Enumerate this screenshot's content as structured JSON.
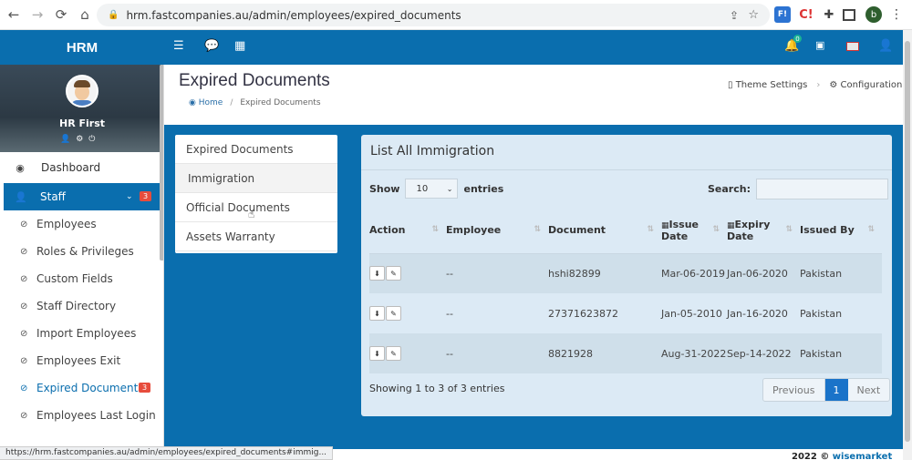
{
  "browser": {
    "url": "hrm.fastcompanies.au/admin/employees/expired_documents",
    "status_url": "https://hrm.fastcompanies.au/admin/employees/expired_documents#immig...",
    "profile_initial": "b",
    "ext_fl": "F!",
    "ext_c": "C!"
  },
  "topbar": {
    "brand": "HRM",
    "bell_count": "0"
  },
  "sidebar": {
    "user_name": "HR First",
    "dashboard_label": "Dashboard",
    "staff_label": "Staff",
    "staff_badge": "3",
    "items": [
      {
        "label": "Employees"
      },
      {
        "label": "Roles & Privileges"
      },
      {
        "label": "Custom Fields"
      },
      {
        "label": "Staff Directory"
      },
      {
        "label": "Import Employees"
      },
      {
        "label": "Employees Exit"
      },
      {
        "label": "Expired Documents",
        "badge": "3",
        "active": true
      },
      {
        "label": "Employees Last Login"
      }
    ]
  },
  "header": {
    "title": "Expired Documents",
    "breadcrumb_home": "Home",
    "breadcrumb_current": "Expired Documents",
    "theme_settings": "Theme Settings",
    "configuration": "Configuration"
  },
  "doc_tabs": [
    {
      "label": "Expired Documents"
    },
    {
      "label": "Immigration"
    },
    {
      "label": "Official Documents"
    },
    {
      "label": "Assets Warranty"
    }
  ],
  "list": {
    "title": "List All Immigration",
    "show_label": "Show",
    "entries_label": "entries",
    "page_size": "10",
    "search_label": "Search:",
    "search_value": "",
    "columns": {
      "action": "Action",
      "employee": "Employee",
      "document": "Document",
      "issue_date": "Issue Date",
      "expiry_date": "Expiry Date",
      "issued_by": "Issued By"
    },
    "rows": [
      {
        "employee": "--",
        "document": "hshi82899",
        "issue_date": "Mar-06-2019",
        "expiry_date": "Jan-06-2020",
        "issued_by": "Pakistan"
      },
      {
        "employee": "--",
        "document": "27371623872",
        "issue_date": "Jan-05-2010",
        "expiry_date": "Jan-16-2020",
        "issued_by": "Pakistan"
      },
      {
        "employee": "--",
        "document": "8821928",
        "issue_date": "Aug-31-2022",
        "expiry_date": "Sep-14-2022",
        "issued_by": "Pakistan"
      }
    ],
    "info": "Showing 1 to 3 of 3 entries",
    "pager": {
      "previous": "Previous",
      "current": "1",
      "next": "Next"
    }
  },
  "footer": {
    "copyright": "2022 © ",
    "brand": "wisemarket"
  }
}
